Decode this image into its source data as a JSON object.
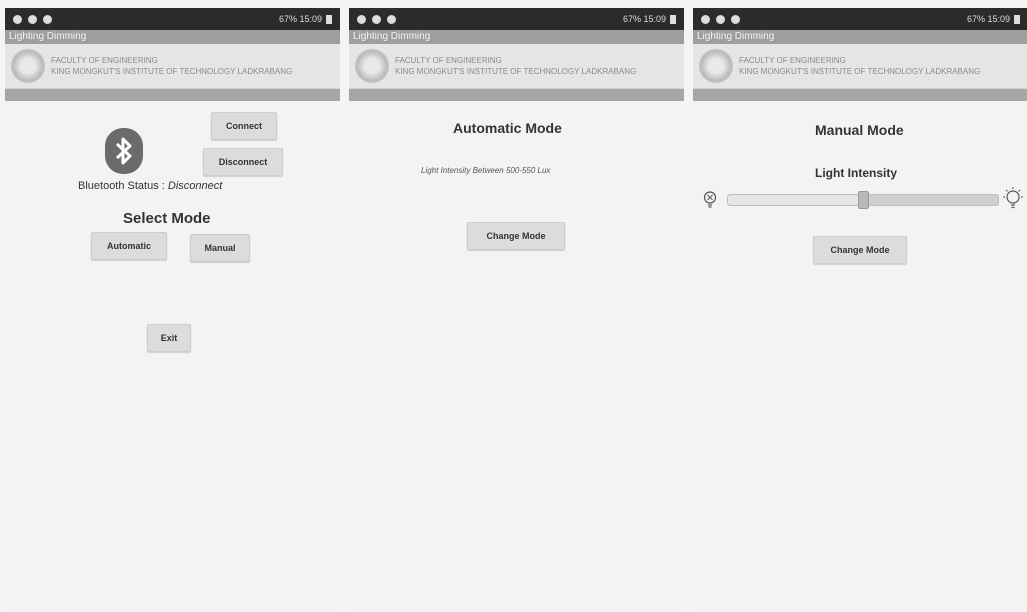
{
  "status_bar": {
    "right_text": "67% 15:09"
  },
  "app_title": "Lighting Dimming",
  "banner": {
    "line1": "FACULTY OF ENGINEERING",
    "line2": "KING MONGKUT'S INSTITUTE OF TECHNOLOGY LADKRABANG"
  },
  "screen1": {
    "connect_label": "Connect",
    "disconnect_label": "Disconnect",
    "bt_status_label": "Bluetooth Status :",
    "bt_status_value": "Disconnect",
    "select_mode_title": "Select Mode",
    "automatic_label": "Automatic",
    "manual_label": "Manual",
    "exit_label": "Exit"
  },
  "screen2": {
    "title": "Automatic Mode",
    "info_text": "Light Intensity Between 500-550 Lux",
    "change_mode_label": "Change Mode"
  },
  "screen3": {
    "title": "Manual Mode",
    "slider_label": "Light Intensity",
    "slider_value_fraction": 0.5,
    "change_mode_label": "Change Mode"
  },
  "icons": [
    "bluetooth-icon",
    "bulb-off-icon",
    "bulb-on-icon"
  ]
}
